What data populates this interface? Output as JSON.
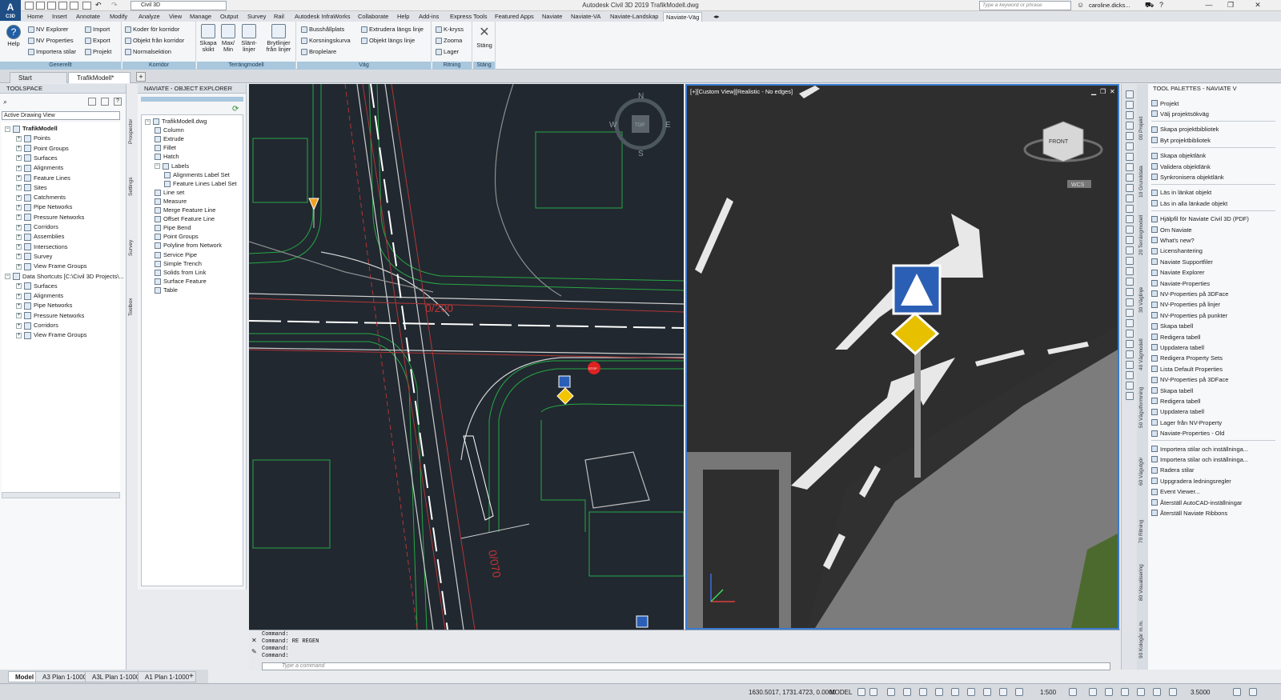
{
  "titlebar": {
    "app_logo": "A",
    "app_sub": "C3D",
    "workspace": "Civil 3D",
    "window_title": "Autodesk Civil 3D 2019   TrafikModell.dwg",
    "search_placeholder": "Type a keyword or phrase",
    "user": "caroline.dicks...",
    "min": "—",
    "max": "❐",
    "close": "✕"
  },
  "ribbon_tabs": [
    "Home",
    "Insert",
    "Annotate",
    "Modify",
    "Analyze",
    "View",
    "Manage",
    "Output",
    "Survey",
    "Rail",
    "Autodesk InfraWorks",
    "Collaborate",
    "Help",
    "Add-ins",
    "Express Tools",
    "Featured Apps",
    "Naviate",
    "Naviate-VA",
    "Naviate-Landskap",
    "Naviate-Väg"
  ],
  "active_ribbon_tab": "Naviate-Väg",
  "ribbon": {
    "generellt": {
      "title": "Generellt",
      "help": "Help",
      "items": [
        "NV Explorer",
        "NV Properties",
        "Importera stilar",
        "Import",
        "Export",
        "Projekt"
      ]
    },
    "korridor": {
      "title": "Korridor",
      "items": [
        "Koder för korridor",
        "Objekt från korridor",
        "Normalsektion"
      ]
    },
    "terrang": {
      "title": "Terrängmodell",
      "items": [
        "Skapa skikt",
        "Max/ Min",
        "Slänt- linjer",
        "Brytlinjer från linjer"
      ]
    },
    "vag": {
      "title": "Väg",
      "items": [
        "Busshållplats",
        "Korsningskurva",
        "Broplelare",
        "Extrudera längs linje",
        "Objekt längs linje"
      ]
    },
    "ritning": {
      "title": "Ritning",
      "items": [
        "K-kryss",
        "Zooma",
        "Lager"
      ]
    },
    "stang": {
      "title": "Stäng",
      "label": "Stäng"
    }
  },
  "doc_tabs": [
    "Start",
    "TrafikModell*"
  ],
  "toolspace": {
    "title": "TOOLSPACE",
    "view_select": "Active Drawing View",
    "tree": [
      {
        "label": "TrafikModell",
        "level": 0,
        "bold": true
      },
      {
        "label": "Points",
        "level": 1
      },
      {
        "label": "Point Groups",
        "level": 1
      },
      {
        "label": "Surfaces",
        "level": 1
      },
      {
        "label": "Alignments",
        "level": 1
      },
      {
        "label": "Feature Lines",
        "level": 1
      },
      {
        "label": "Sites",
        "level": 1
      },
      {
        "label": "Catchments",
        "level": 1
      },
      {
        "label": "Pipe Networks",
        "level": 1
      },
      {
        "label": "Pressure Networks",
        "level": 1
      },
      {
        "label": "Corridors",
        "level": 1
      },
      {
        "label": "Assemblies",
        "level": 1
      },
      {
        "label": "Intersections",
        "level": 1
      },
      {
        "label": "Survey",
        "level": 1
      },
      {
        "label": "View Frame Groups",
        "level": 1
      },
      {
        "label": "Data Shortcuts [C:\\Civil 3D Projects\\...",
        "level": 0
      },
      {
        "label": "Surfaces",
        "level": 1
      },
      {
        "label": "Alignments",
        "level": 1
      },
      {
        "label": "Pipe Networks",
        "level": 1
      },
      {
        "label": "Pressure Networks",
        "level": 1
      },
      {
        "label": "Corridors",
        "level": 1
      },
      {
        "label": "View Frame Groups",
        "level": 1
      }
    ],
    "side_tabs": [
      "Prospector",
      "Settings",
      "Survey",
      "Toolbox"
    ]
  },
  "explorer": {
    "title": "NAVIATE - OBJECT EXPLORER",
    "tree": [
      {
        "label": "TrafikModell.dwg",
        "level": 0
      },
      {
        "label": "Column",
        "level": 1
      },
      {
        "label": "Extrude",
        "level": 1
      },
      {
        "label": "Fillet",
        "level": 1
      },
      {
        "label": "Hatch",
        "level": 1
      },
      {
        "label": "Labels",
        "level": 1
      },
      {
        "label": "Alignments Label Set",
        "level": 2
      },
      {
        "label": "Feature Lines Label Set",
        "level": 2
      },
      {
        "label": "Line set",
        "level": 1
      },
      {
        "label": "Measure",
        "level": 1
      },
      {
        "label": "Merge Feature Line",
        "level": 1
      },
      {
        "label": "Offset Feature Line",
        "level": 1
      },
      {
        "label": "Pipe Bend",
        "level": 1
      },
      {
        "label": "Point Groups",
        "level": 1
      },
      {
        "label": "Polyline from Network",
        "level": 1
      },
      {
        "label": "Service Pipe",
        "level": 1
      },
      {
        "label": "Simple Trench",
        "level": 1
      },
      {
        "label": "Solids from Link",
        "level": 1
      },
      {
        "label": "Surface Feature",
        "level": 1
      },
      {
        "label": "Table",
        "level": 1
      }
    ]
  },
  "drawing": {
    "compass": {
      "n": "N",
      "s": "S",
      "e": "E",
      "w": "W",
      "top": "TOP"
    },
    "station_labels": [
      "0/200",
      "0/070"
    ],
    "stop_text": "STOP"
  },
  "view3d": {
    "label": "[+][Custom View][Realistic - No edges]",
    "cube_face": "FRONT",
    "wcs": "WCS"
  },
  "command": {
    "lines": [
      "Command:",
      "Command: RE REGEN",
      "Command:",
      "Command:"
    ],
    "placeholder": "Type a command"
  },
  "tool_palette": {
    "title": "TOOL PALETTES - NAVIATE V",
    "groups": [
      [
        "Projekt",
        "Välj projektsökväg"
      ],
      [
        "Skapa projektbibliotek",
        "Byt projektbibliotek"
      ],
      [
        "Skapa objektlänk",
        "Validera objektlänk",
        "Synkronisera objektlänk"
      ],
      [
        "Läs in länkat objekt",
        "Läs in alla länkade objekt"
      ],
      [
        "Hjälpfil för Naviate Civil 3D (PDF)",
        "Om Naviate",
        "What's new?",
        "Licenshantering",
        "Naviate Supportfiler",
        "Naviate Explorer",
        "Naviate-Properties",
        "NV-Properties på 3DFace",
        "NV-Properties på linjer",
        "NV-Properties på punkter",
        "Skapa tabell",
        "Redigera tabell",
        "Uppdatera tabell",
        "Redigera Property Sets",
        "Lista Default Properties",
        "NV-Properties på 3DFace",
        "Skapa tabell",
        "Redigera tabell",
        "Uppdatera tabell",
        "Lager från NV-Property",
        "Naviate-Properties - Old"
      ],
      [
        "Importera stilar och inställninga...",
        "Importera stilar och inställninga...",
        "Radera stilar",
        "Uppgradera ledningsregler",
        "Event Viewer...",
        "Återställ AutoCAD-inställningar",
        "Återställ Naviate Ribbons"
      ]
    ],
    "side_tabs": [
      "00 Projekt",
      "10 Grunddata",
      "20 Terrängmodell",
      "30 Väglinje",
      "40 Vägmodell",
      "50 Vägutformning",
      "60 Vägutgör",
      "70 Ritning",
      "80 Visualisering",
      "90 Kologår m.m."
    ]
  },
  "layout_tabs": [
    "Model",
    "A3 Plan 1-1000",
    "A3L Plan 1-1000",
    "A1 Plan 1-1000"
  ],
  "status": {
    "coords": "1630.5017, 1731.4723, 0.0000",
    "space": "MODEL",
    "scale": "1:500",
    "zoom": "3.5000"
  },
  "colors": {
    "accent": "#3b7bd1",
    "drawing_bg": "#212830",
    "render_bg": "#303030",
    "ribbon_panel": "#a9c7dd"
  }
}
